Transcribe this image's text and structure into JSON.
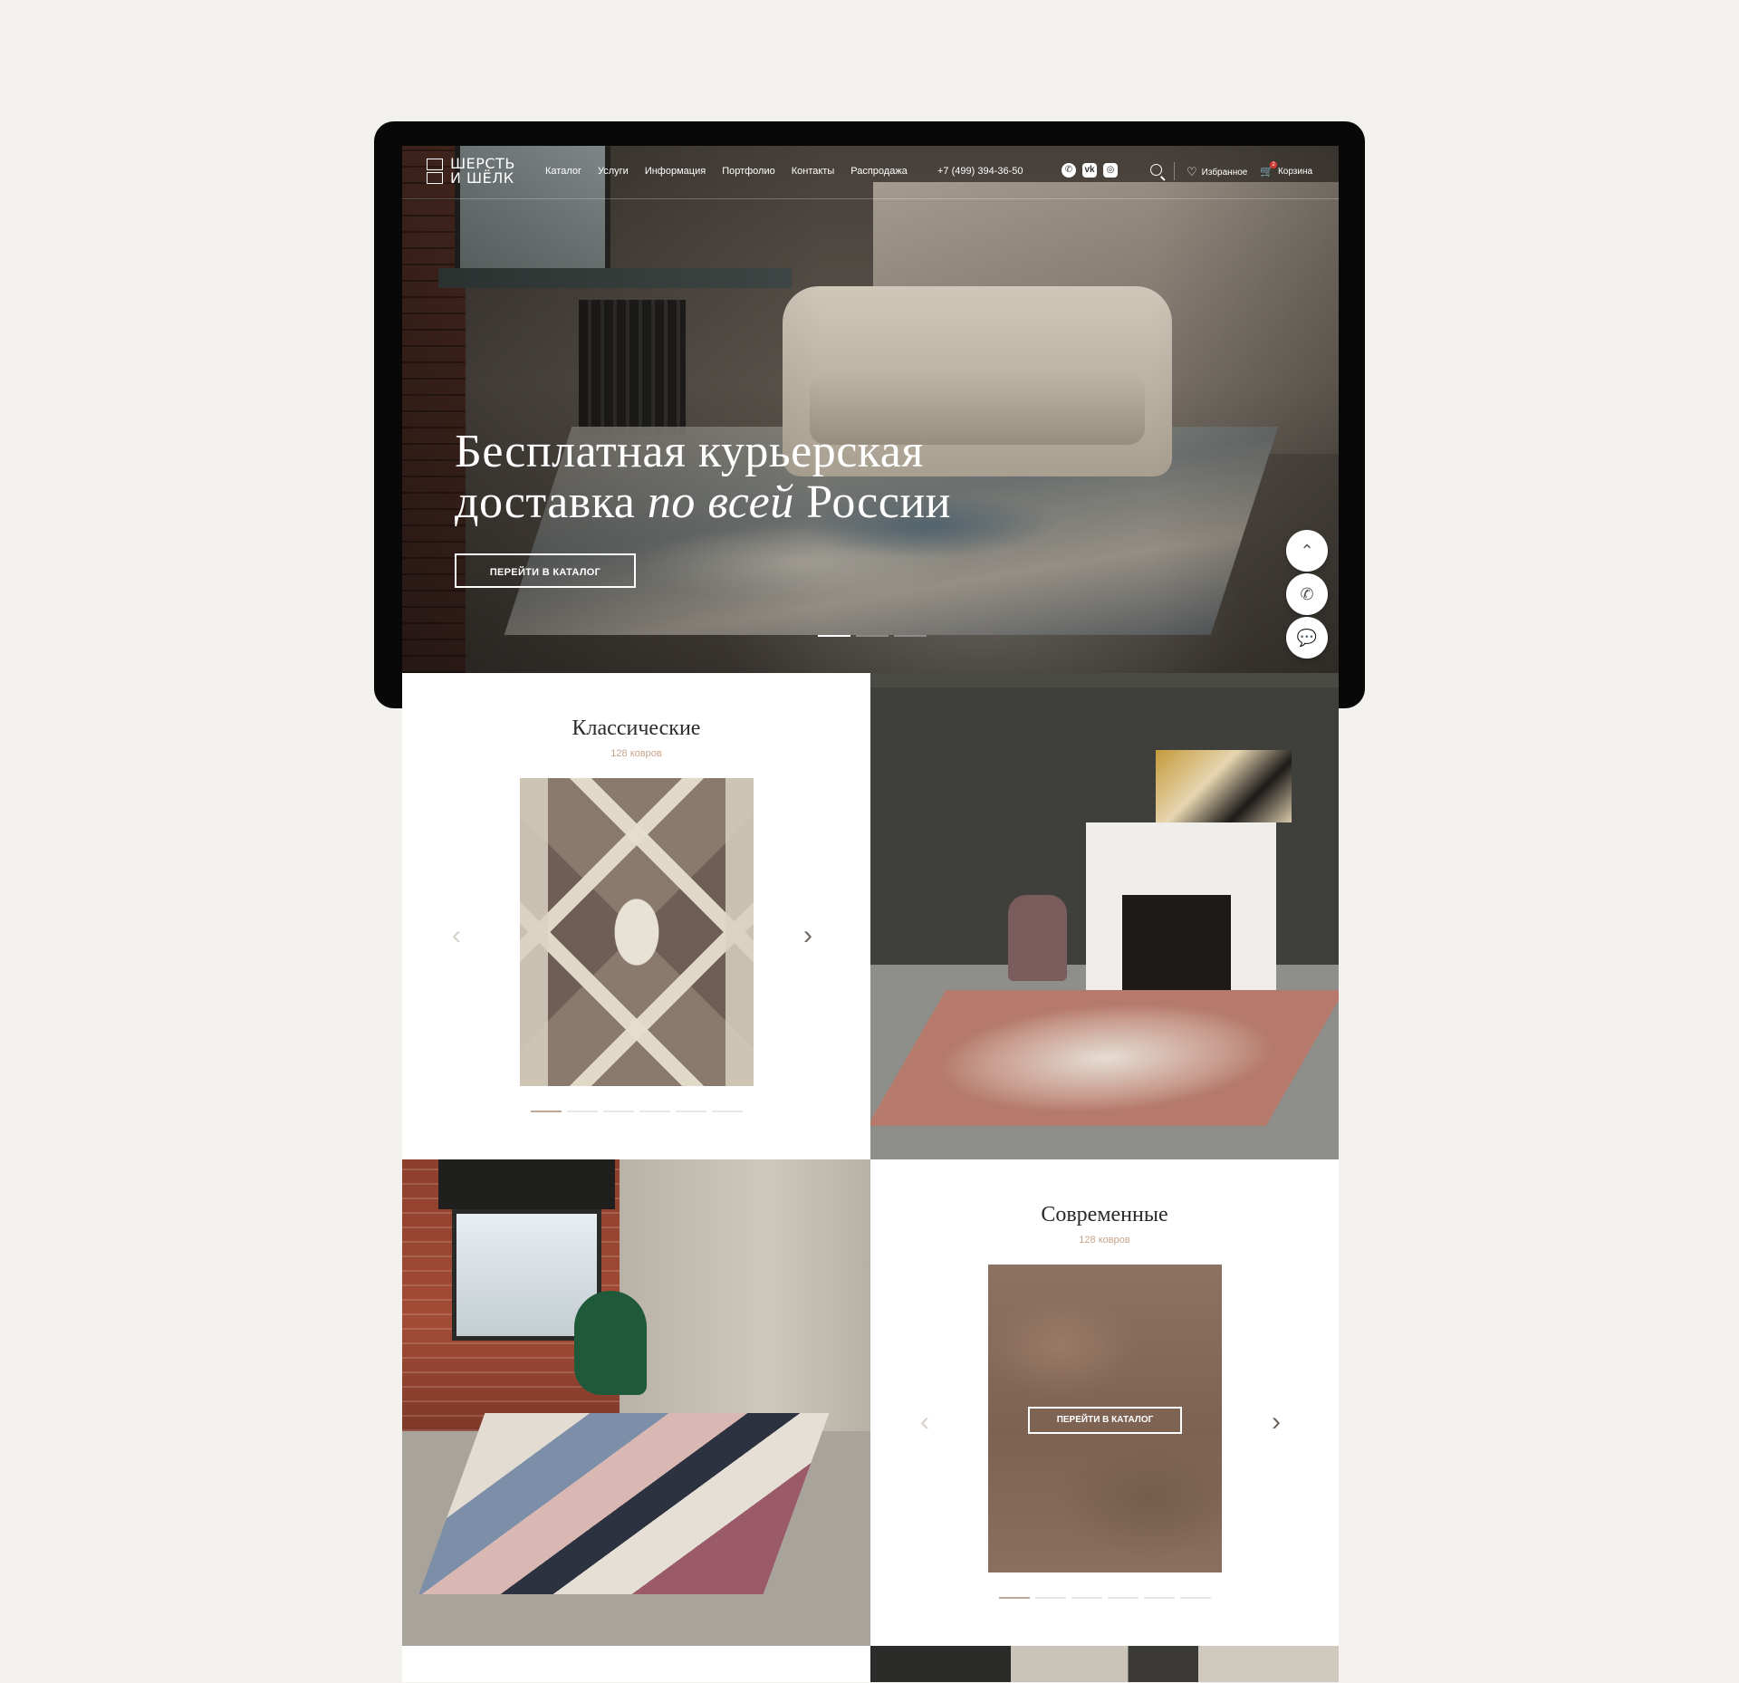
{
  "header": {
    "logo_line1": "ШЕРСТЬ",
    "logo_line2": "И ШЁЛК",
    "menu": [
      "Каталог",
      "Услуги",
      "Информация",
      "Портфолио",
      "Контакты",
      "Распродажа"
    ],
    "phone": "+7 (499) 394-36-50",
    "socials": [
      "whatsapp-icon",
      "vk-icon",
      "instagram-icon"
    ],
    "favorites_label": "Избранное",
    "cart_label": "Корзина",
    "cart_count": "2"
  },
  "hero": {
    "title_line1": "Бесплатная курьерская",
    "title_line2_a": "доставка ",
    "title_line2_italic": "по всей",
    "title_line2_b": " России",
    "button_label": "ПЕРЕЙТИ В КАТАЛОГ",
    "slides_total": 3,
    "active_slide": 1
  },
  "floating_buttons": [
    "scroll-up-icon",
    "phone-icon",
    "chat-icon"
  ],
  "categories": [
    {
      "title": "Классические",
      "count": "128 ковров",
      "pager_total": 6,
      "pager_active": 1
    },
    {
      "title": "Современные",
      "count": "128 ковров",
      "button_label": "ПЕРЕЙТИ В КАТАЛОГ",
      "pager_total": 6,
      "pager_active": 1
    }
  ],
  "colors": {
    "page_bg": "#f2f1ee",
    "device_frame": "#080808",
    "accent": "#c7a58d",
    "cart_badge": "#d43a2f"
  }
}
